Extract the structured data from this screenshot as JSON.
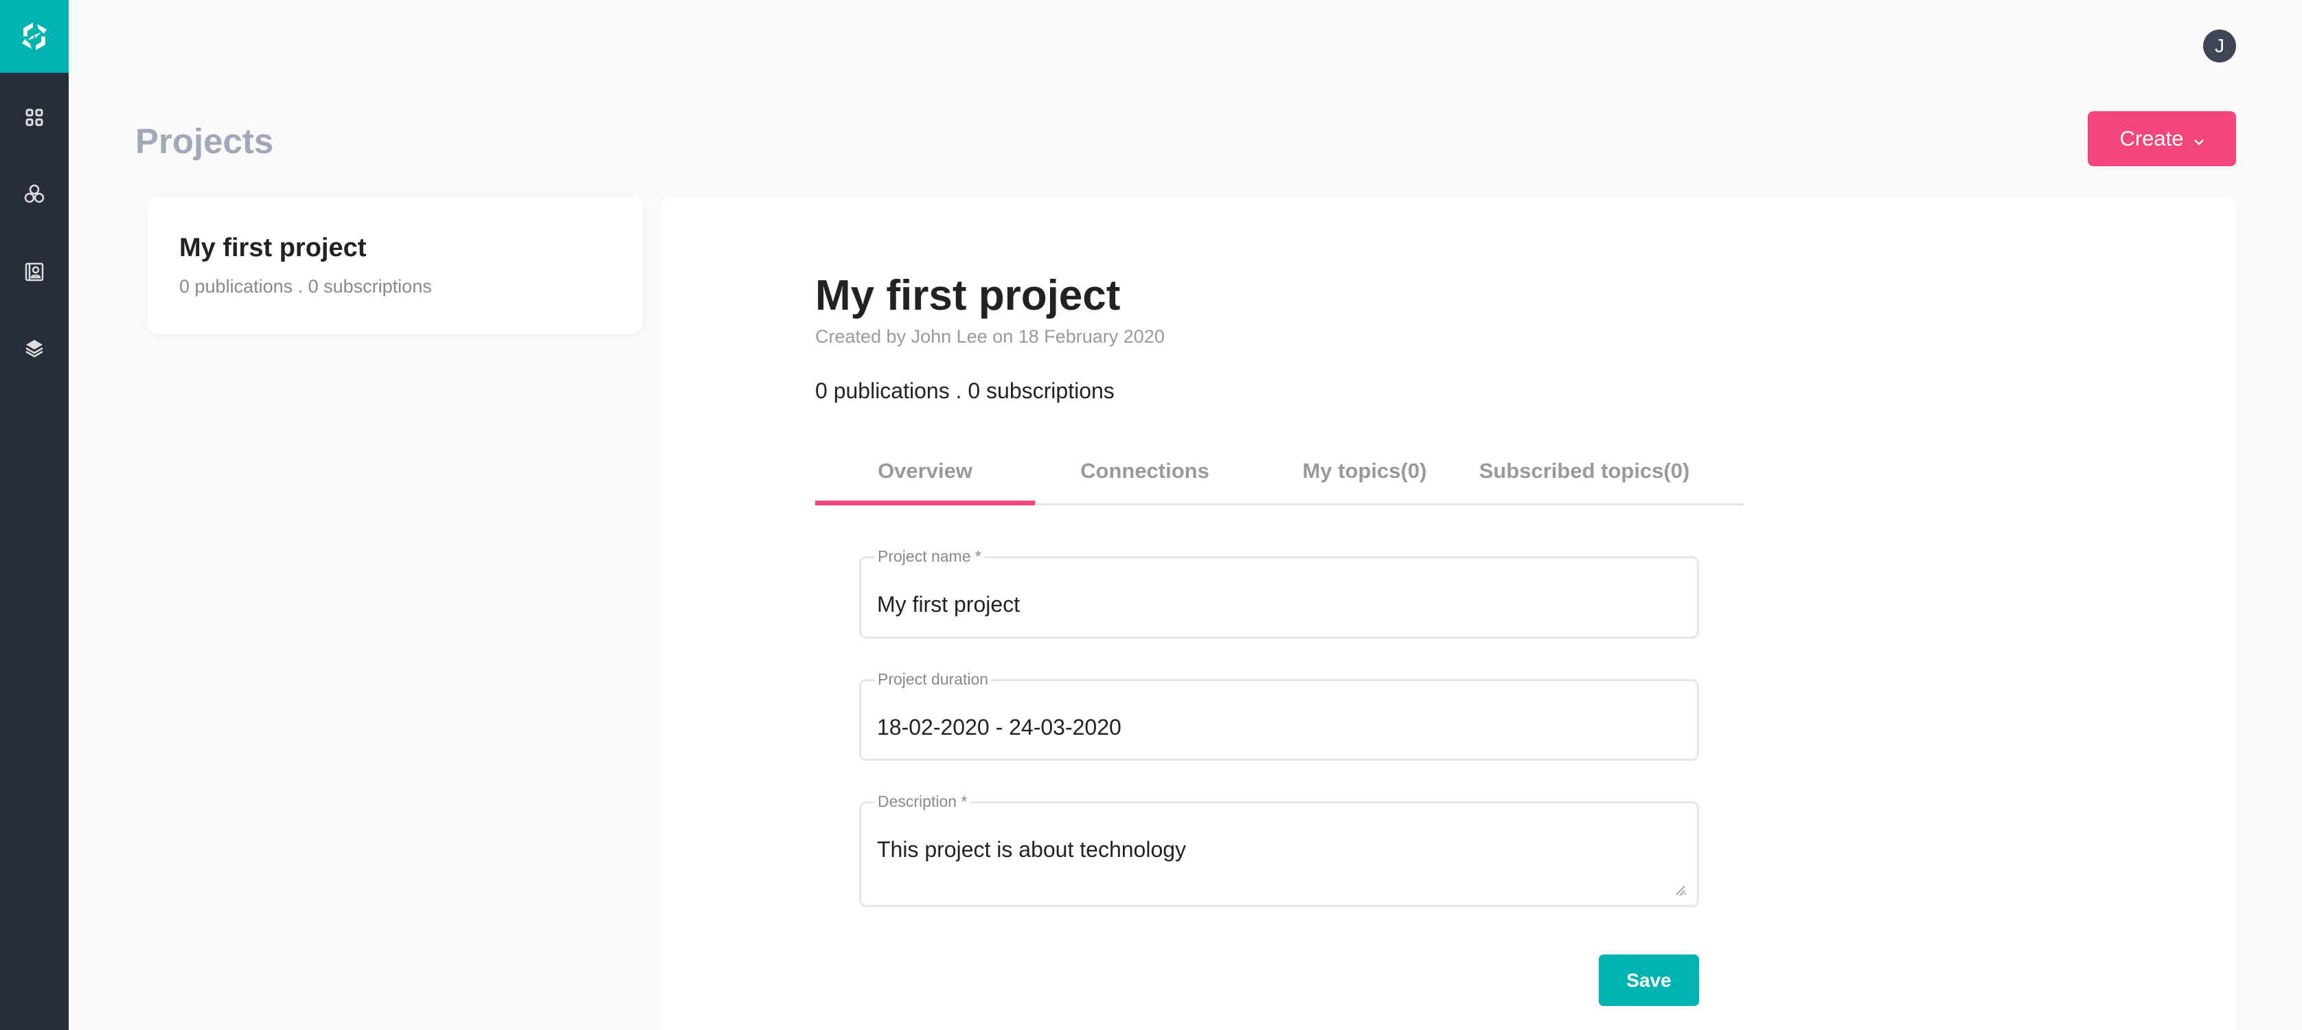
{
  "user": {
    "avatar_initial": "J"
  },
  "header": {
    "title": "Projects",
    "create_label": "Create"
  },
  "project_list": [
    {
      "title": "My first project",
      "stats": "0 publications . 0 subscriptions"
    }
  ],
  "detail": {
    "title": "My first project",
    "created_by": "Created by John Lee on 18 February 2020",
    "stats": "0 publications . 0 subscriptions",
    "tabs": [
      {
        "label": "Overview",
        "active": true
      },
      {
        "label": "Connections"
      },
      {
        "label": "My topics(0)"
      },
      {
        "label": "Subscribed topics(0)"
      }
    ],
    "form": {
      "project_name": {
        "label": "Project name *",
        "value": "My first project"
      },
      "duration": {
        "label": "Project duration",
        "value": "18-02-2020 - 24-03-2020"
      },
      "description": {
        "label": "Description *",
        "value": "This project is about technology"
      },
      "save_label": "Save"
    }
  },
  "colors": {
    "accent": "#f3477c",
    "teal": "#00b3b0",
    "sidebar": "#272d3a"
  }
}
